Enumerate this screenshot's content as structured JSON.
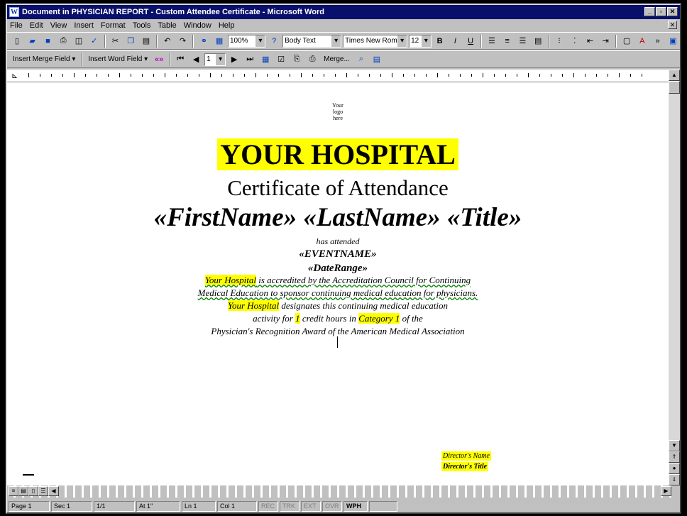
{
  "window": {
    "title": "Document in PHYSICIAN REPORT - Custom Attendee Certificate - Microsoft Word",
    "min": "_",
    "max": "▫",
    "close": "✕"
  },
  "menu": [
    "File",
    "Edit",
    "View",
    "Insert",
    "Format",
    "Tools",
    "Table",
    "Window",
    "Help"
  ],
  "toolbar1": {
    "zoom": "100%",
    "style": "Body Text",
    "font": "Times New Roman",
    "size": "12",
    "bold": "B",
    "italic": "I",
    "underline": "U"
  },
  "toolbar2": {
    "insert_merge_field": "Insert Merge Field ▾",
    "insert_word_field": "Insert Word Field ▾",
    "record_number": "1",
    "merge_label": "Merge..."
  },
  "document": {
    "logo_lines": [
      "Your",
      "logo",
      "here"
    ],
    "hospital": "YOUR HOSPITAL",
    "certificate": "Certificate of Attendance",
    "names": "«FirstName» «LastName» «Title»",
    "attended": "has attended",
    "event": "«EVENTNAME»",
    "date_range": "«DateRange»",
    "accreditation_l1_hl": "Your Hospital",
    "accreditation_l1": " is accredited by the Accreditation Council for Continuing",
    "accreditation_l2": "Medical Education to sponsor continuing medical education for physicians.",
    "designates_hl": "Your Hospital",
    "designates": " designates this continuing medical education",
    "credit_pre": "activity for ",
    "credit_hours": "1",
    "credit_mid": " credit hours in ",
    "credit_category": "Category 1",
    "credit_post": " of the",
    "award": "Physician's Recognition Award of the American Medical Association",
    "signature_name": "Director's Name",
    "signature_title": "Director's Title"
  },
  "status": {
    "page": "Page 1",
    "sec": "Sec 1",
    "position": "1/1",
    "at": "At 1\"",
    "ln": "Ln 1",
    "col": "Col 1",
    "rec": "REC",
    "trk": "TRK",
    "ext": "EXT",
    "ovr": "OVR",
    "wph": "WPH"
  }
}
